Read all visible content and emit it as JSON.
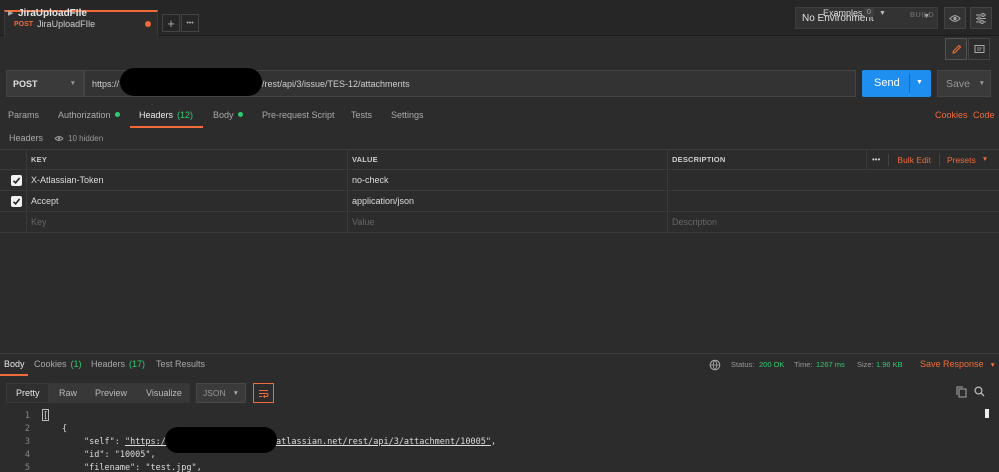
{
  "tabbar": {
    "tab_method": "POST",
    "tab_title": "JiraUploadFIle",
    "add_label": "+",
    "more_label": "•••",
    "environment": "No Environment"
  },
  "request": {
    "name": "JiraUploadFIle",
    "examples_label": "Examples",
    "examples_count": "0",
    "build_label": "BUILD",
    "method": "POST",
    "url_prefix": "https://",
    "url_suffix": "/rest/api/3/issue/TES-12/attachments",
    "send_label": "Send",
    "save_label": "Save"
  },
  "request_tabs": [
    {
      "label": "Params"
    },
    {
      "label": "Authorization"
    },
    {
      "label": "Headers",
      "count": "(12)"
    },
    {
      "label": "Body"
    },
    {
      "label": "Pre-request Script"
    },
    {
      "label": "Tests"
    },
    {
      "label": "Settings"
    }
  ],
  "links": {
    "cookies": "Cookies",
    "code": "Code"
  },
  "headers_sub": {
    "title": "Headers",
    "hidden": "10 hidden"
  },
  "headers_table": {
    "columns": [
      "KEY",
      "VALUE",
      "DESCRIPTION"
    ],
    "bulk_edit": "Bulk Edit",
    "presets": "Presets",
    "more": "•••",
    "rows": [
      {
        "key": "X-Atlassian-Token",
        "value": "no-check",
        "description": ""
      },
      {
        "key": "Accept",
        "value": "application/json",
        "description": ""
      }
    ],
    "placeholders": {
      "key": "Key",
      "value": "Value",
      "description": "Description"
    }
  },
  "response": {
    "tabs": [
      {
        "label": "Body"
      },
      {
        "label": "Cookies",
        "count": "(1)"
      },
      {
        "label": "Headers",
        "count": "(17)"
      },
      {
        "label": "Test Results"
      }
    ],
    "status_label": "Status:",
    "status_value": "200 OK",
    "time_label": "Time:",
    "time_value": "1267 ms",
    "size_label": "Size:",
    "size_value": "1.96 KB",
    "save_response": "Save Response",
    "formats": [
      "Pretty",
      "Raw",
      "Preview",
      "Visualize"
    ],
    "format_type": "JSON",
    "code": {
      "line_numbers": [
        "1",
        "2",
        "3",
        "4",
        "5"
      ],
      "l1": "[",
      "l2": "{",
      "l3_key": "\"self\": ",
      "l3_pre": "\"https://",
      "l3_post": "atlassian.net/rest/api/3/attachment/10005\"",
      "l3_end": ",",
      "l4": "\"id\": \"10005\",",
      "l5": "\"filename\": \"test.jpg\","
    }
  },
  "colors": {
    "accent": "#f26b3a",
    "send": "#1f8ef1",
    "ok": "#2ecc71",
    "bg": "#2c2c2c"
  }
}
